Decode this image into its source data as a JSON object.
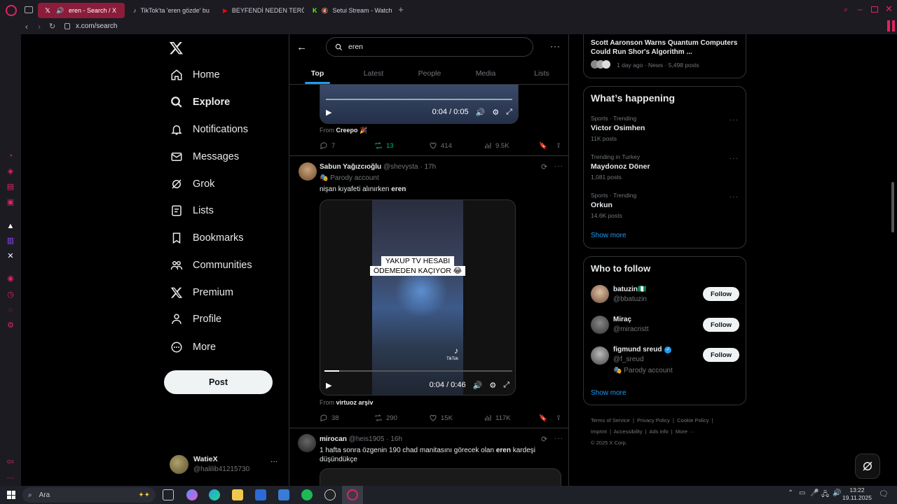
{
  "browser": {
    "tabs": [
      {
        "title": "eren - Search / X",
        "icon": "x-logo-icon"
      },
      {
        "title": "TikTok'ta 'eren gözde' bu",
        "icon": "tiktok-icon"
      },
      {
        "title": "BEYFENDİ NEDEN TERÖR",
        "icon": "youtube-icon"
      },
      {
        "title": "Setui Stream - Watch",
        "icon": "kick-icon"
      }
    ],
    "address": "x.com/search"
  },
  "nav": {
    "items": [
      {
        "label": "Home",
        "icon": "home-icon"
      },
      {
        "label": "Explore",
        "icon": "search-icon"
      },
      {
        "label": "Notifications",
        "icon": "bell-icon"
      },
      {
        "label": "Messages",
        "icon": "mail-icon"
      },
      {
        "label": "Grok",
        "icon": "grok-icon"
      },
      {
        "label": "Lists",
        "icon": "list-icon"
      },
      {
        "label": "Bookmarks",
        "icon": "bookmark-icon"
      },
      {
        "label": "Communities",
        "icon": "people-icon"
      },
      {
        "label": "Premium",
        "icon": "x-logo-icon"
      },
      {
        "label": "Profile",
        "icon": "person-icon"
      },
      {
        "label": "More",
        "icon": "more-circle-icon"
      }
    ],
    "post_label": "Post",
    "account": {
      "name": "WatieX",
      "handle": "@halilib41215730"
    }
  },
  "search": {
    "query": "eren",
    "tabs": [
      "Top",
      "Latest",
      "People",
      "Media",
      "Lists"
    ]
  },
  "feed": {
    "post1": {
      "video_time": "0:04 / 0:05",
      "from_prefix": "From",
      "from_name": "Creepo 🎉",
      "replies": "7",
      "reposts": "13",
      "likes": "414",
      "views": "9.5K"
    },
    "post2": {
      "name": "Sabun Yağızcıoğlu",
      "handle": "@shevysta",
      "time": "· 17h",
      "badge": "Parody account",
      "text_before": "nişan kıyafeti alınırken ",
      "text_bold": "eren",
      "video_caption_line1": "YAKUP TV HESABI",
      "video_caption_line2": "ÖDEMEDEN KAÇIYOR 😂",
      "video_time": "0:04 / 0:46",
      "video_watermark": "TikTok",
      "from_prefix": "From",
      "from_name": "virtuoz arşiv",
      "replies": "38",
      "reposts": "290",
      "likes": "15K",
      "views": "117K"
    },
    "post3": {
      "name": "mirocan",
      "handle": "@heis1905",
      "time": "· 16h",
      "text_before": "1 hafta sonra özgenin 190 chad manitasını görecek olan ",
      "text_bold": "eren",
      "text_after": " kardeşi düşündükçe"
    }
  },
  "right": {
    "news": {
      "title": "Scott Aaronson Warns Quantum Computers Could Run Shor's Algorithm ...",
      "meta": "1 day ago · News · 5,498 posts"
    },
    "happening": {
      "title": "What’s happening",
      "trends": [
        {
          "meta": "Sports · Trending",
          "name": "Victor Osimhen",
          "count": "11K posts"
        },
        {
          "meta": "Trending in Turkey",
          "name": "Maydonoz Döner",
          "count": "1,081 posts"
        },
        {
          "meta": "Sports · Trending",
          "name": "Orkun",
          "count": "14.6K posts"
        }
      ],
      "show_more": "Show more"
    },
    "follow": {
      "title": "Who to follow",
      "users": [
        {
          "name": "batuzin🇳🇬",
          "handle": "@bbatuzin",
          "button": "Follow"
        },
        {
          "name": "Miraç",
          "handle": "@miracristt",
          "button": "Follow"
        },
        {
          "name": "figmund sreud",
          "handle": "@f_sreud",
          "badge": "Parody account",
          "button": "Follow"
        }
      ],
      "show_more": "Show more"
    },
    "footer": {
      "links_row1": [
        "Terms of Service",
        "Privacy Policy",
        "Cookie Policy"
      ],
      "links_row2": [
        "Imprint",
        "Accessibility",
        "Ads info",
        "More ···"
      ],
      "copyright": "© 2025 X Corp."
    }
  },
  "taskbar": {
    "search_placeholder": "Ara",
    "time": "13:22",
    "date": "19.11.2025"
  },
  "colors": {
    "accent": "#1d9bf0",
    "repost_green": "#00ba7c",
    "opera_red": "#e0245e"
  }
}
